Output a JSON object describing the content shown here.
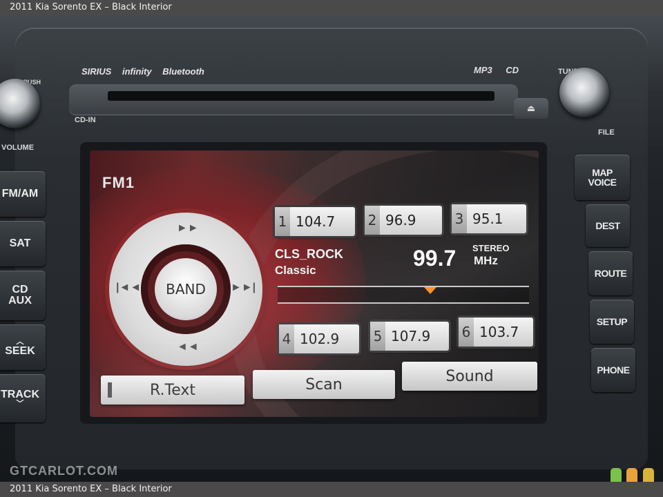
{
  "caption": {
    "top": "2011 Kia Sorento EX – Black Interior",
    "bottom": "2011 Kia Sorento EX – Black Interior"
  },
  "hardware": {
    "brands": [
      "SIRIUS",
      "infinity",
      "Bluetooth"
    ],
    "formats": [
      "MP3",
      "CD"
    ],
    "cd_in_label": "CD-IN",
    "push_label": "PUSH",
    "tune_label": "TUNE",
    "volume_label": "VOLUME",
    "file_label": "FILE",
    "eject_label": "⏏",
    "left_buttons": {
      "fm_am": "FM/AM",
      "sat": "SAT",
      "cd_aux_1": "CD",
      "cd_aux_2": "AUX",
      "seek": "SEEK",
      "track": "TRACK"
    },
    "right_buttons": {
      "map_voice_1": "MAP",
      "map_voice_2": "VOICE",
      "dest": "DEST",
      "route": "ROUTE",
      "setup": "SETUP",
      "phone": "PHONE"
    }
  },
  "screen": {
    "band_label": "FM1",
    "band_button": "BAND",
    "dpad_icons": {
      "up": "fast-forward-icon",
      "down": "rewind-icon",
      "left": "skip-previous-icon",
      "right": "skip-next-icon"
    },
    "presets": [
      {
        "num": "1",
        "freq": "104.7"
      },
      {
        "num": "2",
        "freq": "96.9"
      },
      {
        "num": "3",
        "freq": "95.1"
      },
      {
        "num": "4",
        "freq": "102.9"
      },
      {
        "num": "5",
        "freq": "107.9"
      },
      {
        "num": "6",
        "freq": "103.7"
      }
    ],
    "station": {
      "name": "CLS_ROCK",
      "genre": "Classic",
      "frequency": "99.7",
      "stereo": "STEREO",
      "unit": "MHz"
    },
    "softkeys": {
      "rtext": "R.Text",
      "scan": "Scan",
      "sound": "Sound"
    },
    "colors": {
      "accent_red": "#8a2a2d",
      "marker_orange": "#ff8a1c"
    }
  },
  "watermark": "GTCARLOT.COM",
  "watermark_lights": [
    "#7cc14a",
    "#e8a23a",
    "#d8b23a"
  ]
}
